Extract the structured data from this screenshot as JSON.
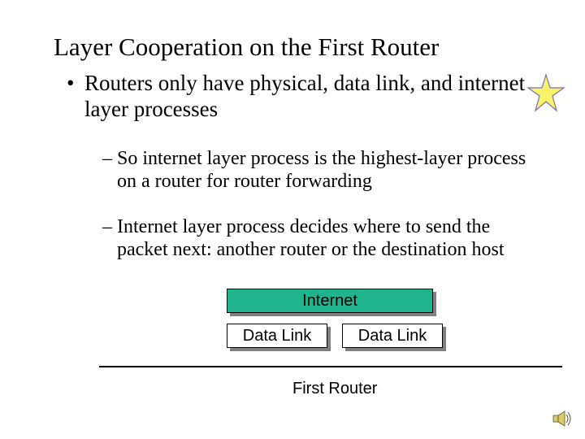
{
  "title": "Layer Cooperation on the First Router",
  "bullets": {
    "b1": "Routers only have physical, data link, and internet layer processes",
    "s1": "So internet layer process is the highest-layer process on a router for router forwarding",
    "s2": "Internet layer process decides where to send the packet next: another router or the destination host"
  },
  "diagram": {
    "internet": "Internet",
    "datalink_left": "Data Link",
    "datalink_right": "Data Link",
    "caption": "First Router"
  },
  "icons": {
    "star": "star-icon",
    "speaker": "speaker-icon"
  },
  "colors": {
    "internet_fill": "#1fb38e",
    "star_fill": "#f9f26a",
    "star_stroke": "#7a6fb0"
  }
}
